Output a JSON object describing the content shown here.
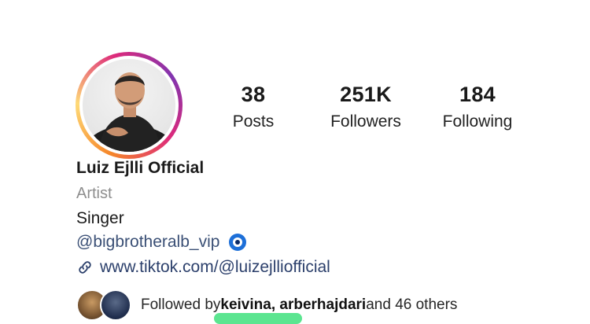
{
  "profile": {
    "posts_count": "38",
    "posts_label": "Posts",
    "followers_count": "251K",
    "followers_label": "Followers",
    "following_count": "184",
    "following_label": "Following",
    "name": "Luiz Ejlli Official",
    "category": "Artist",
    "bio": "Singer",
    "mention": "@bigbrotheralb_vip",
    "link": "www.tiktok.com/@luizejlliofficial",
    "followed_by_prefix": "Followed by ",
    "followed_by_users": "keivina, arberhajdari",
    "followed_by_suffix": " and 46 others"
  },
  "colors": {
    "link": "#2b3f6b",
    "muted": "#8e8e8e",
    "highlight": "#3ee07c"
  }
}
